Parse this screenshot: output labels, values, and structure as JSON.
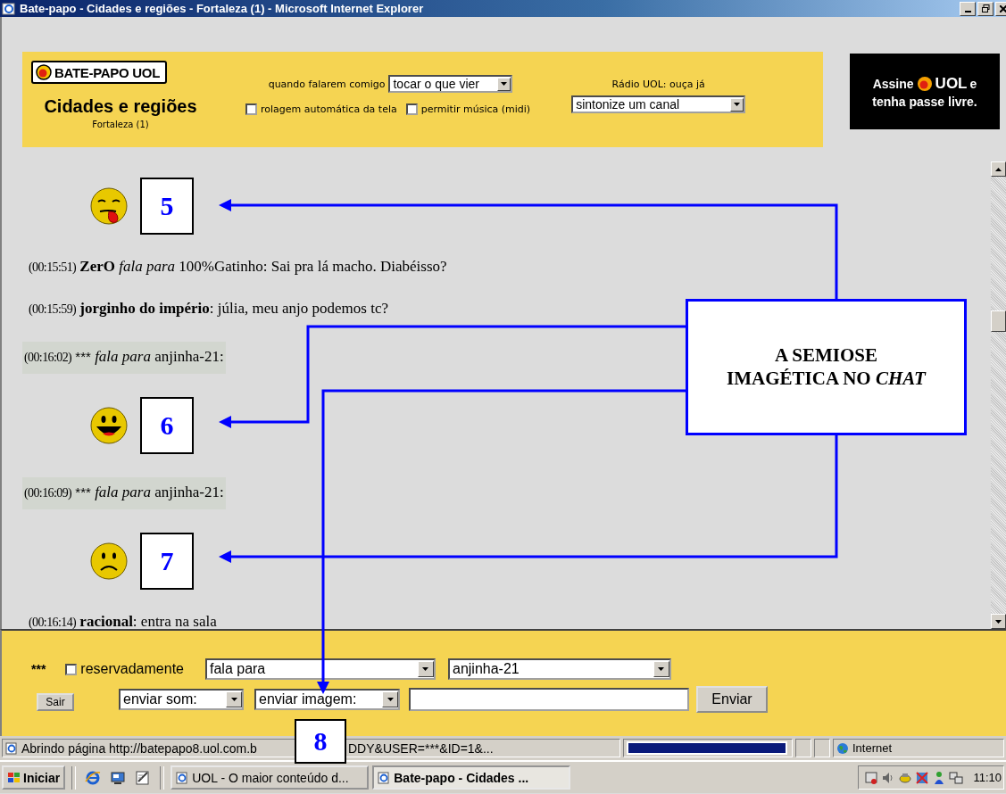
{
  "window": {
    "title": "Bate-papo - Cidades e regiões - Fortaleza (1) - Microsoft Internet Explorer"
  },
  "header": {
    "logo": "BATE-PAPO UOL",
    "room_title": "Cidades e regiões",
    "room_subtitle": "Fortaleza (1)",
    "notify_label": "quando falarem comigo",
    "notify_select": "tocar o que vier",
    "options": [
      {
        "label": "rolagem automática da tela",
        "checked": false
      },
      {
        "label": "permitir música (midi)",
        "checked": false
      }
    ],
    "radio_label": "Rádio UOL: ouça já",
    "radio_select": "sintonize um canal"
  },
  "ad": {
    "prefix": "Assine",
    "brand": "UOL",
    "suffix": "e",
    "line_2": "tenha passe livre."
  },
  "chat": {
    "items": [
      {
        "kind": "tongue",
        "callout": "5"
      },
      {
        "kind": "message",
        "time": "(00:15:51)",
        "text": "**ZerO** *fala para* 100%Gatinho: Sai pra lá macho. Diabéisso?",
        "highlighted": false
      },
      {
        "kind": "message",
        "time": "(00:15:59)",
        "text": "**jorginho do império**: júlia, meu anjo podemos tc?",
        "highlighted": false
      },
      {
        "kind": "message",
        "time": "(00:16:02)",
        "sender": "***",
        "text": "*fala para* anjinha-21:",
        "highlighted": true
      },
      {
        "kind": "laugh",
        "callout": "6"
      },
      {
        "kind": "message",
        "time": "(00:16:09)",
        "sender": "***",
        "text": "*fala para* anjinha-21:",
        "highlighted": true
      },
      {
        "kind": "frown",
        "callout": "7"
      },
      {
        "kind": "message",
        "time": "(00:16:14)",
        "text": "**racional**: entra na sala",
        "highlighted": false
      }
    ]
  },
  "compose": {
    "nickname": "***",
    "private": {
      "label": "reservadamente",
      "checked": false
    },
    "action_select": "fala para",
    "recipient_select": "anjinha-21",
    "exit_button": "Sair",
    "sound_select": "enviar som:",
    "image_select": "enviar imagem:",
    "send_button": "Enviar"
  },
  "status_bar": {
    "text_before": "Abrindo página http://batepapo8.uol.com.b",
    "text_after": "DDY&USER=***&ID=1&...",
    "progress": {
      "level": 1
    },
    "zone": "Internet"
  },
  "taskbar": {
    "start": "Iniciar",
    "tasks": [
      {
        "label": "UOL - O maior conteúdo d...",
        "selected": false
      },
      {
        "label": "Bate-papo - Cidades ...",
        "selected": true
      }
    ],
    "clock": "11:10"
  },
  "annotation": {
    "title": "A SEMIOSE IMAGÉTICA NO *CHAT*",
    "callout": "8"
  }
}
